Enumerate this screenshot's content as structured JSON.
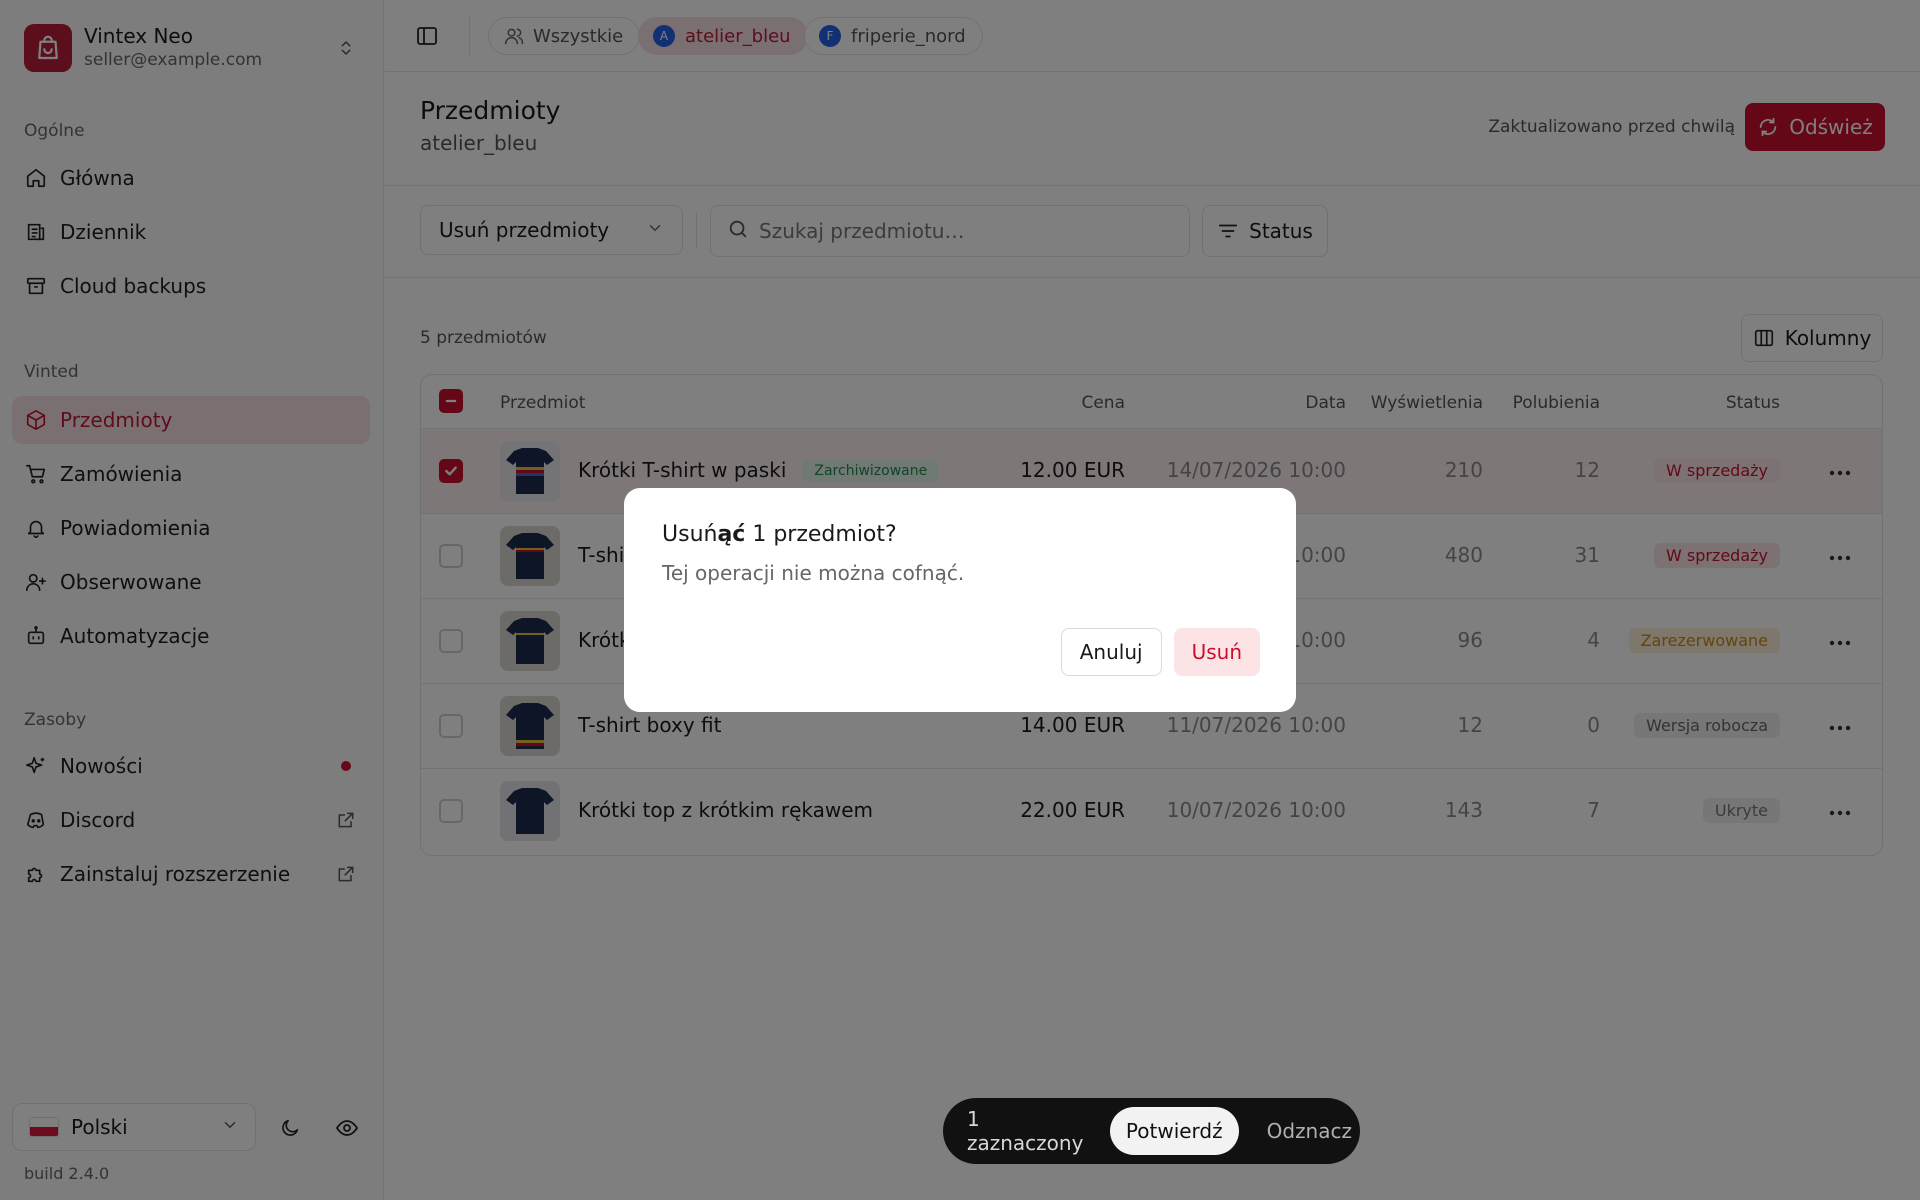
{
  "account": {
    "name": "Vintex Neo",
    "email": "seller@example.com"
  },
  "sidebar": {
    "sections": [
      {
        "label": "Ogólne",
        "items": [
          {
            "label": "Główna",
            "icon": "home-icon"
          },
          {
            "label": "Dziennik",
            "icon": "log-icon"
          },
          {
            "label": "Cloud backups",
            "icon": "archive-icon"
          }
        ]
      },
      {
        "label": "Vinted",
        "items": [
          {
            "label": "Przedmioty",
            "icon": "package-icon",
            "active": true
          },
          {
            "label": "Zamówienia",
            "icon": "cart-icon"
          },
          {
            "label": "Powiadomienia",
            "icon": "bell-icon"
          },
          {
            "label": "Obserwowane",
            "icon": "user-plus-icon"
          },
          {
            "label": "Automatyzacje",
            "icon": "bot-icon"
          }
        ]
      },
      {
        "label": "Zasoby",
        "items": [
          {
            "label": "Nowości",
            "icon": "sparkles-icon"
          },
          {
            "label": "Discord",
            "icon": "discord-icon"
          },
          {
            "label": "Zainstaluj rozszerzenie",
            "icon": "puzzle-icon"
          }
        ]
      }
    ],
    "language": "Polski",
    "build": "build 2.4.0"
  },
  "topbar": {
    "chips": [
      {
        "label": "Wszystkie"
      },
      {
        "label": "atelier_bleu",
        "avatar": "A",
        "active": true
      },
      {
        "label": "friperie_nord",
        "avatar": "F"
      }
    ]
  },
  "page": {
    "title": "Przedmioty",
    "subtitle": "atelier_bleu",
    "updated": "Zaktualizowano przed chwilą",
    "refresh_label": "Odśwież"
  },
  "filters": {
    "action_select": "Usuń przedmioty",
    "search_placeholder": "Szukaj przedmiotu…",
    "status_label": "Status"
  },
  "table": {
    "count": "5 przedmiotów",
    "columns_label": "Kolumny",
    "headers": {
      "item": "Przedmiot",
      "price": "Cena",
      "date": "Data",
      "views": "Wyświetlenia",
      "likes": "Polubienia",
      "status": "Status"
    },
    "rows": [
      {
        "name": "Krótki T-shirt w paski",
        "tag": "Zarchiwizowane",
        "price": "12.00 EUR",
        "date": "14/07/2026 10:00",
        "views": "210",
        "likes": "12",
        "status": "W sprzedaży",
        "status_kind": "sale",
        "selected": true
      },
      {
        "name": "T-shi",
        "tag": "",
        "price": "",
        "date": "10:00",
        "views": "480",
        "likes": "31",
        "status": "W sprzedaży",
        "status_kind": "sale",
        "selected": false
      },
      {
        "name": "Krótk",
        "tag": "",
        "price": "",
        "date": "10:00",
        "views": "96",
        "likes": "4",
        "status": "Zarezerwowane",
        "status_kind": "res",
        "selected": false
      },
      {
        "name": "T-shirt boxy fit",
        "tag": "",
        "price": "14.00 EUR",
        "date": "11/07/2026 10:00",
        "views": "12",
        "likes": "0",
        "status": "Wersja robocza",
        "status_kind": "draft",
        "selected": false
      },
      {
        "name": "Krótki top z krótkim rękawem",
        "tag": "",
        "price": "22.00 EUR",
        "date": "10/07/2026 10:00",
        "views": "143",
        "likes": "7",
        "status": "Ukryte",
        "status_kind": "hid",
        "selected": false
      }
    ]
  },
  "dialog": {
    "title_pre": "Usuń",
    "title_bold": "ąć",
    "title_post": " 1 przedmiot?",
    "description": "Tej operacji nie można cofnąć.",
    "cancel": "Anuluj",
    "confirm": "Usuń"
  },
  "action_bar": {
    "count": "1 zaznaczony",
    "confirm": "Potwierdź",
    "clear": "Odznacz"
  },
  "colors": {
    "accent": "#c8102e",
    "accent_soft": "#f5dfe2"
  }
}
